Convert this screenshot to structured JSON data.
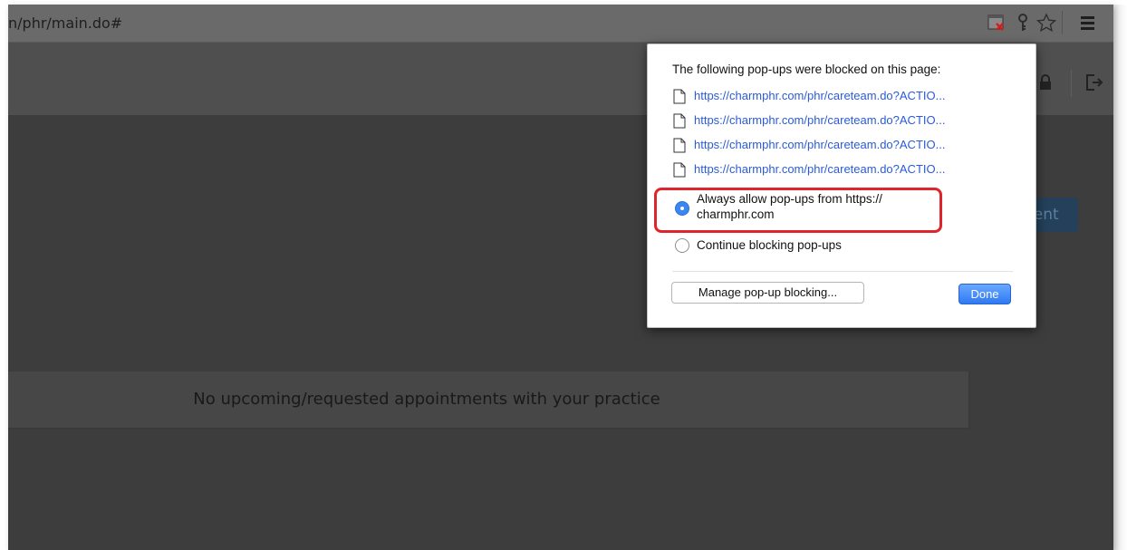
{
  "browser": {
    "url": "n/phr/main.do#",
    "icons": [
      "popup-blocked-icon",
      "key-icon",
      "star-icon",
      "menu-icon"
    ]
  },
  "app_header": {
    "icons": [
      "lock-icon",
      "logout-icon"
    ]
  },
  "main": {
    "obscured_button_label": "nent",
    "appointments_empty": "No upcoming/requested appointments with your practice"
  },
  "popup": {
    "title": "The following pop-ups were blocked on this page:",
    "links": [
      "https://charmphr.com/phr/careteam.do?ACTIO...",
      "https://charmphr.com/phr/careteam.do?ACTIO...",
      "https://charmphr.com/phr/careteam.do?ACTIO...",
      "https://charmphr.com/phr/careteam.do?ACTIO..."
    ],
    "option_allow_line1": "Always allow pop-ups from https://",
    "option_allow_line2": "charmphr.com",
    "option_block": "Continue blocking pop-ups",
    "selected_option": "allow",
    "manage_label": "Manage pop-up blocking...",
    "done_label": "Done"
  },
  "colors": {
    "highlight": "#e0242c",
    "link": "#2a5bd7",
    "done_button": "#2f7af2"
  }
}
